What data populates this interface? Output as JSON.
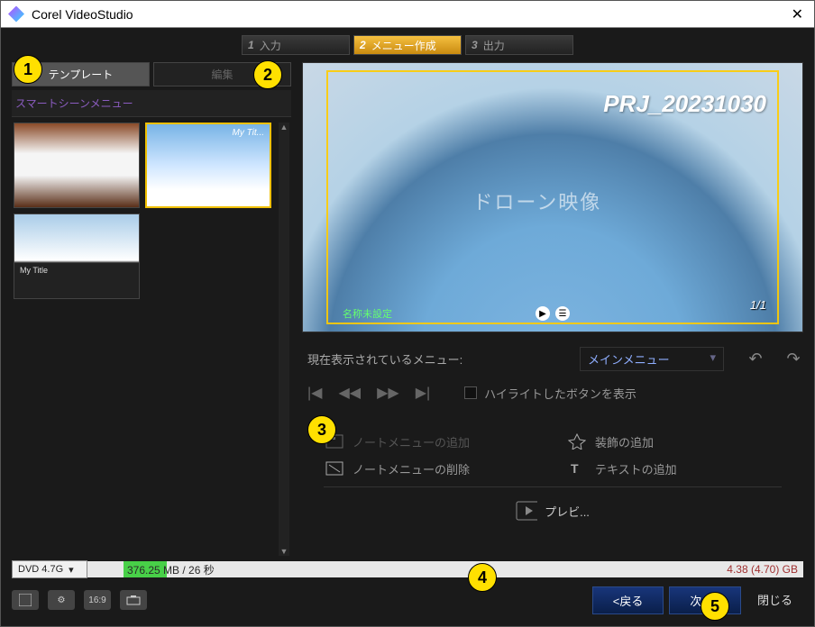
{
  "window": {
    "title": "Corel VideoStudio"
  },
  "steps": [
    {
      "num": "1",
      "label": "入力"
    },
    {
      "num": "2",
      "label": "メニュー作成"
    },
    {
      "num": "3",
      "label": "出力"
    }
  ],
  "left_tabs": {
    "template": "テンプレート",
    "edit": "編集"
  },
  "section_label": "スマートシーンメニュー",
  "preview": {
    "project_title": "PRJ_20231030",
    "overlay_text": "ドローン映像",
    "page_indicator": "1/1",
    "name_unset": "名称未設定"
  },
  "menu_row": {
    "label": "現在表示されているメニュー:",
    "selected": "メインメニュー"
  },
  "highlight_label": "ハイライトしたボタンを表示",
  "tools": {
    "add_note_menu": "ノートメニューの追加",
    "del_note_menu": "ノートメニューの削除",
    "add_decoration": "装飾の追加",
    "add_text": "テキストの追加",
    "preview": "プレビ..."
  },
  "size": {
    "disc_type": "DVD 4.7G",
    "used": "376.25 MB / 26 秒",
    "total": "4.38 (4.70) GB"
  },
  "bottom_icons": {
    "aspect": "16:9"
  },
  "nav": {
    "back": "<戻る",
    "next": "次へ>",
    "close": "閉じる"
  },
  "callouts": [
    "1",
    "2",
    "3",
    "4",
    "5"
  ]
}
